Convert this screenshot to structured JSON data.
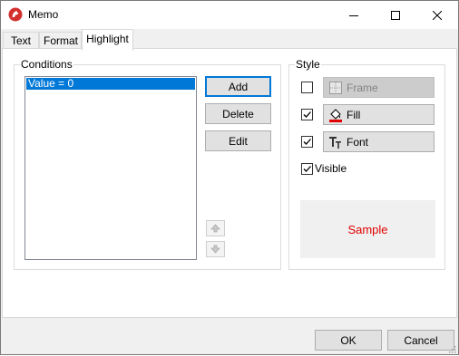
{
  "window": {
    "title": "Memo",
    "app_icon": "memo-app-icon",
    "controls": [
      "minimize-icon",
      "maximize-icon",
      "close-icon"
    ]
  },
  "tabs": [
    {
      "label": "Text",
      "active": false
    },
    {
      "label": "Format",
      "active": false
    },
    {
      "label": "Highlight",
      "active": true
    }
  ],
  "conditions": {
    "label": "Conditions",
    "items": [
      "Value = 0"
    ],
    "selected_index": 0,
    "buttons": {
      "add": "Add",
      "delete": "Delete",
      "edit": "Edit"
    },
    "move_icons": [
      "move-up-icon",
      "move-down-icon"
    ]
  },
  "style": {
    "label": "Style",
    "frame": {
      "label": "Frame",
      "checked": false,
      "enabled": false,
      "icon": "frame-icon"
    },
    "fill": {
      "label": "Fill",
      "checked": true,
      "enabled": true,
      "icon": "fill-bucket-icon"
    },
    "font": {
      "label": "Font",
      "checked": true,
      "enabled": true,
      "icon": "font-icon"
    },
    "visible": {
      "label": "Visible",
      "checked": true
    },
    "sample": {
      "text": "Sample",
      "color": "#e00000",
      "background": "#f0f0f0"
    }
  },
  "footer": {
    "ok": "OK",
    "cancel": "Cancel"
  },
  "colors": {
    "accent": "#0078d7",
    "button_bg": "#e1e1e1",
    "sample_text": "#e00000"
  }
}
